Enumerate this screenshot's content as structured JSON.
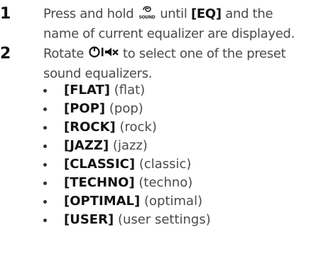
{
  "steps": [
    {
      "number": "1",
      "line1_before": "Press and hold",
      "icon_label": "SOUND",
      "line1_after": "until",
      "keyword": "[EQ]",
      "line1_end": "and the",
      "line2": "name of current equalizer are displayed.",
      "icon": "sound-button-icon"
    },
    {
      "number": "2",
      "line1_before": "Rotate",
      "line1_after": "to select one of the preset",
      "line2": "sound equalizers.",
      "icon": "rotary-volume-knob-icon"
    }
  ],
  "equalizers": [
    {
      "name": "[FLAT]",
      "desc": "(flat)"
    },
    {
      "name": "[POP]",
      "desc": "(pop)"
    },
    {
      "name": "[ROCK]",
      "desc": "(rock)"
    },
    {
      "name": "[JAZZ]",
      "desc": "(jazz)"
    },
    {
      "name": "[CLASSIC]",
      "desc": "(classic)"
    },
    {
      "name": "[TECHNO]",
      "desc": "(techno)"
    },
    {
      "name": "[OPTIMAL]",
      "desc": "(optimal)"
    },
    {
      "name": "[USER]",
      "desc": "(user settings)"
    }
  ]
}
